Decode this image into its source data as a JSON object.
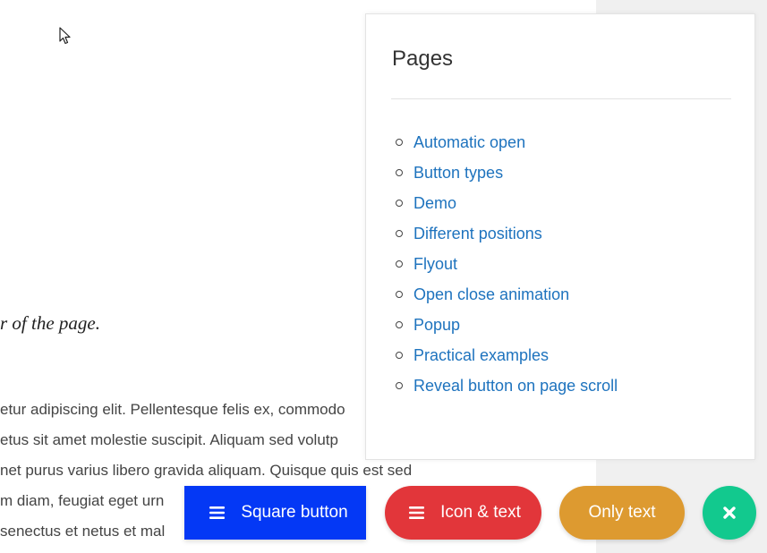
{
  "content": {
    "italic_text": "r of the page.",
    "paragraph_lines": [
      "etur adipiscing elit. Pellentesque felis ex, commodo",
      "etus sit amet molestie suscipit. Aliquam sed volutp",
      "net purus varius libero gravida aliquam. Quisque quis est sed",
      "m diam, feugiat eget urn",
      " senectus et netus et mal"
    ]
  },
  "panel": {
    "title": "Pages",
    "items": [
      {
        "label": "Automatic open"
      },
      {
        "label": "Button types"
      },
      {
        "label": "Demo"
      },
      {
        "label": "Different positions"
      },
      {
        "label": "Flyout"
      },
      {
        "label": "Open close animation"
      },
      {
        "label": "Popup"
      },
      {
        "label": "Practical examples"
      },
      {
        "label": "Reveal button on page scroll"
      }
    ]
  },
  "buttons": {
    "square": {
      "label": "Square button",
      "icon": "menu-icon",
      "color": "#0438f5"
    },
    "icon_text": {
      "label": "Icon & text",
      "icon": "menu-icon",
      "color": "#e2363a"
    },
    "only_text": {
      "label": "Only text",
      "color": "#dd9a30"
    },
    "close": {
      "icon": "close-icon",
      "color": "#12c98e"
    }
  },
  "colors": {
    "link": "#1e73be",
    "sidebar_bg": "#f0f0f0"
  }
}
